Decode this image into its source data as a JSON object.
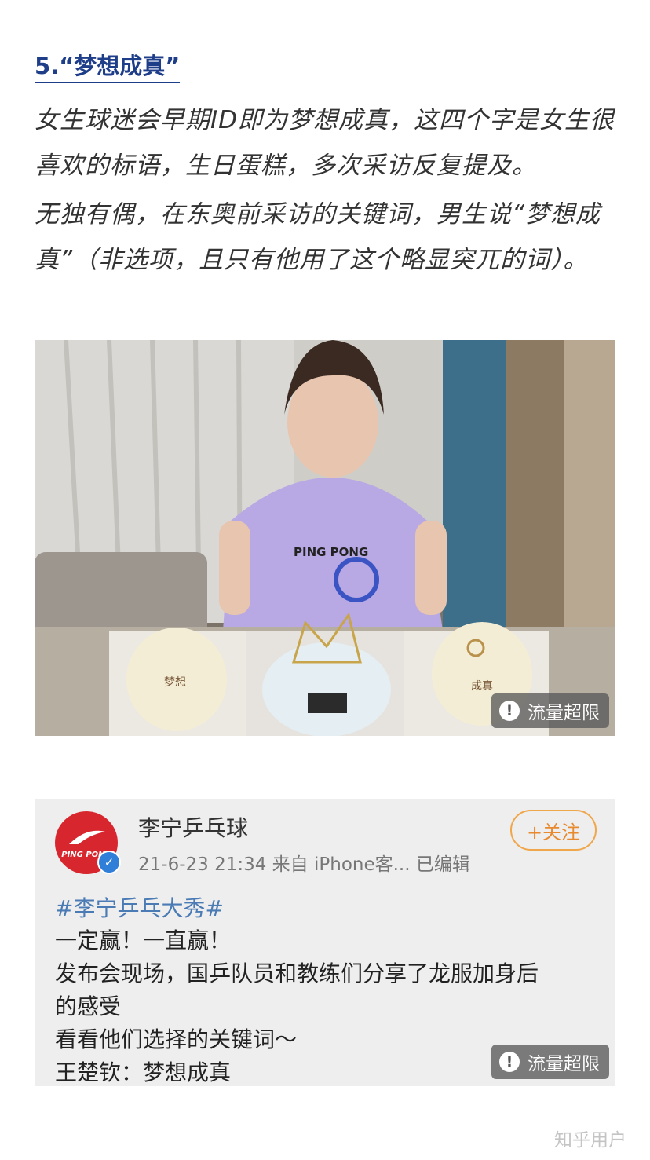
{
  "article": {
    "heading": "5.“梦想成真”",
    "paragraph1": "女生球迷会早期ID即为梦想成真，这四个字是女生很喜欢的标语，生日蛋糕，多次采访反复提及。",
    "paragraph2": "无独有偶，在东奥前采访的关键词，男生说“梦想成真”（非选项，且只有他用了这个略显突兀的词）。"
  },
  "photo": {
    "shirt_text": "PING PONG",
    "left_cake_text": "梦想",
    "right_cake_text": "成真",
    "overlay_label": "流量超限"
  },
  "weibo_card": {
    "avatar_text": "PING PONG",
    "account_name": "李宁乒乓球",
    "meta": "21-6-23 21:34  来自 iPhone客...  已编辑",
    "follow_label": "+关注",
    "topic": "#李宁乒乓大秀#",
    "lines": [
      "一定赢！一直赢！",
      "发布会现场，国乒队员和教练们分享了龙服加身后",
      "的感受",
      "看看他们选择的关键词～",
      "王楚钦：梦想成真"
    ],
    "overlay_label": "流量超限"
  },
  "watermark": "知乎用户",
  "colors": {
    "heading": "#1f3e8a",
    "avatar_red": "#d7262e",
    "follow_orange": "#e8892d",
    "topic_blue": "#4a7bb5"
  }
}
